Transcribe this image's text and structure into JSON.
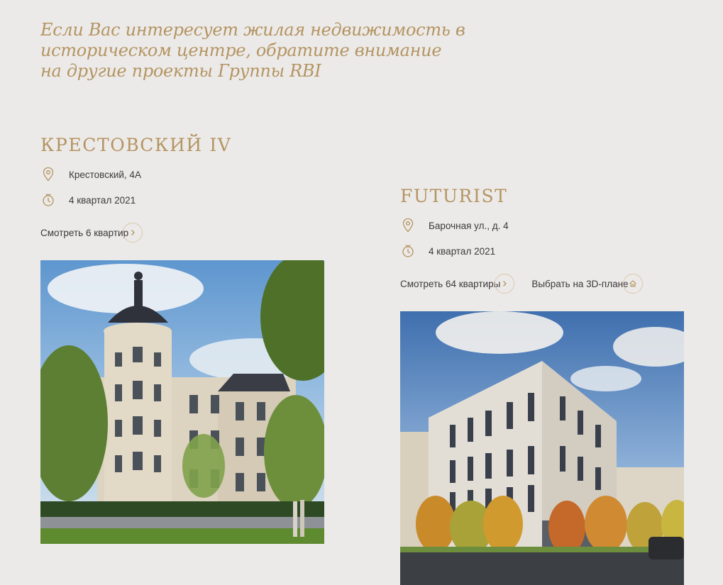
{
  "intro_text": "Если Вас интересует жилая недвижимость в историческом центре, обратите внимание на другие проекты Группы RBI",
  "colors": {
    "accent": "#B49462",
    "background": "#ECEAE8",
    "text": "#3A3A3A"
  },
  "projects": [
    {
      "title": "КРЕСТОВСКИЙ IV",
      "address": "Крестовский, 4А",
      "date": "4 квартал 2021",
      "link_view": "Смотреть 6 квартир",
      "image_alt": "Крестовский IV"
    },
    {
      "title": "FUTURIST",
      "address": "Барочная ул., д. 4",
      "date": "4 квартал 2021",
      "link_view": "Смотреть 64 квартиры",
      "link_3d": "Выбрать на 3D-плане",
      "image_alt": "Futurist"
    }
  ],
  "icons": {
    "location": "map-pin-icon",
    "date": "timer-icon",
    "arrow": "chevron-right-icon",
    "plan3d": "house-icon"
  }
}
